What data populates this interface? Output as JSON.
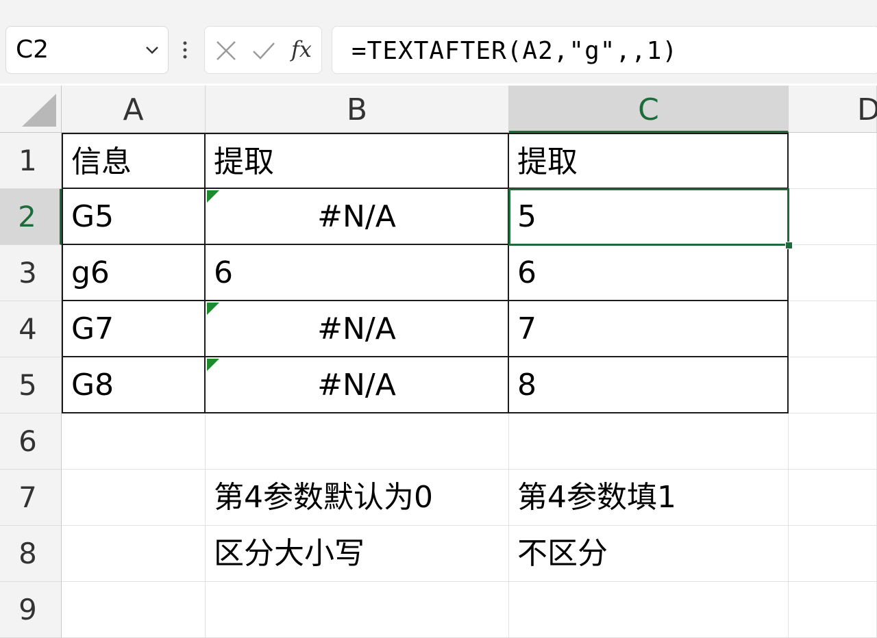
{
  "formula_bar": {
    "name_box": "C2",
    "cancel_icon": "x-icon",
    "enter_icon": "check-icon",
    "fx_label": "fx",
    "formula": "=TEXTAFTER(A2,\"g\",,1)"
  },
  "columns": [
    "A",
    "B",
    "C",
    "D"
  ],
  "selected_column": "C",
  "rows": [
    "1",
    "2",
    "3",
    "4",
    "5",
    "6",
    "7",
    "8",
    "9"
  ],
  "selected_row": "2",
  "cells": {
    "A1": "信息",
    "B1": "提取",
    "C1": "提取",
    "A2": "G5",
    "B2": "#N/A",
    "C2": "5",
    "A3": "g6",
    "B3": "6",
    "C3": "6",
    "A4": "G7",
    "B4": "#N/A",
    "C4": "7",
    "A5": "G8",
    "B5": "#N/A",
    "C5": "8",
    "B7": "第4参数默认为0",
    "C7": "第4参数填1",
    "B8": "区分大小写",
    "C8": "不区分"
  },
  "active_cell": "C2",
  "colors": {
    "accent_green": "#1d6b3b",
    "error_flag_green": "#1e8a2e",
    "header_bg": "#f3f3f3"
  }
}
